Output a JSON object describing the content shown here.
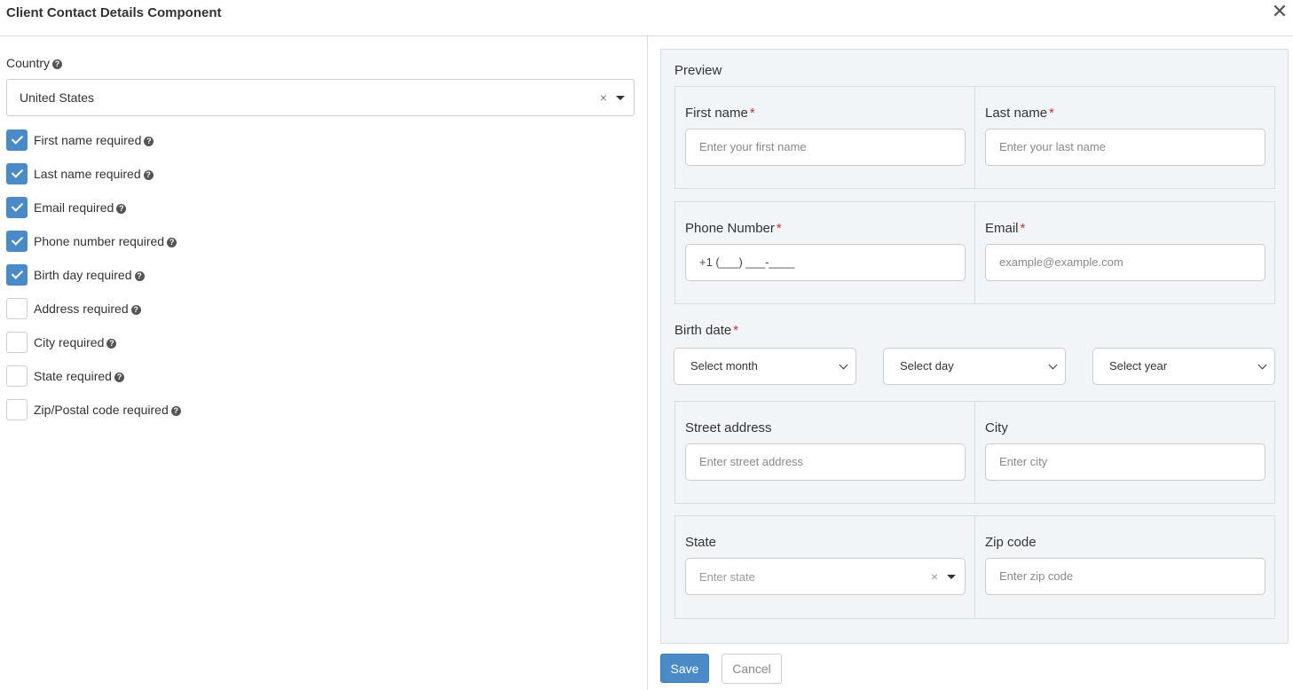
{
  "header": {
    "title": "Client Contact Details Component",
    "close_icon": "close-icon"
  },
  "settings": {
    "country_label": "Country",
    "country_value": "United States",
    "clear_symbol": "×",
    "options": [
      {
        "label": "First name required",
        "checked": true
      },
      {
        "label": "Last name required",
        "checked": true
      },
      {
        "label": "Email required",
        "checked": true
      },
      {
        "label": "Phone number required",
        "checked": true
      },
      {
        "label": "Birth day required",
        "checked": true
      },
      {
        "label": "Address required",
        "checked": false
      },
      {
        "label": "City required",
        "checked": false
      },
      {
        "label": "State required",
        "checked": false
      },
      {
        "label": "Zip/Postal code required",
        "checked": false
      }
    ]
  },
  "preview": {
    "title": "Preview",
    "first_name": {
      "label": "First name",
      "placeholder": "Enter your first name"
    },
    "last_name": {
      "label": "Last name",
      "placeholder": "Enter your last name"
    },
    "phone": {
      "label": "Phone Number",
      "value": "+1 (___) ___-____"
    },
    "email": {
      "label": "Email",
      "placeholder": "example@example.com"
    },
    "birth_date": {
      "label": "Birth date",
      "month": "Select month",
      "day": "Select day",
      "year": "Select year"
    },
    "street": {
      "label": "Street address",
      "placeholder": "Enter street address"
    },
    "city": {
      "label": "City",
      "placeholder": "Enter city"
    },
    "state": {
      "label": "State",
      "placeholder": "Enter state"
    },
    "zip": {
      "label": "Zip code",
      "placeholder": "Enter zip code"
    },
    "required_mark": "*"
  },
  "actions": {
    "save_label": "Save",
    "cancel_label": "Cancel"
  },
  "colors": {
    "accent": "#4a8ac6",
    "required": "#c9302c",
    "preview_bg": "#f2f5f7"
  }
}
